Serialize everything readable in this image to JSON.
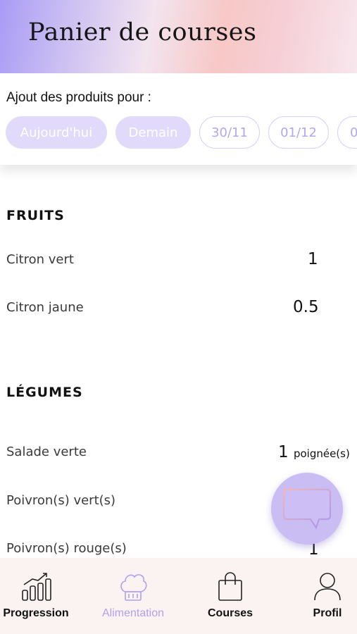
{
  "header": {
    "title": "Panier de courses"
  },
  "date_selector": {
    "label": "Ajout des produits pour :",
    "chips": [
      {
        "label": "Aujourd'hui",
        "state": "selected"
      },
      {
        "label": "Demain",
        "state": "selected"
      },
      {
        "label": "30/11",
        "state": "unselected"
      },
      {
        "label": "01/12",
        "state": "unselected"
      },
      {
        "label": "0",
        "state": "unselected"
      }
    ]
  },
  "sections": [
    {
      "title": "FRUITS",
      "items": [
        {
          "name": "Citron vert",
          "qty": "1",
          "unit": ""
        },
        {
          "name": "Citron jaune",
          "qty": "0.5",
          "unit": ""
        }
      ]
    },
    {
      "title": "LÉGUMES",
      "items": [
        {
          "name": "Salade verte",
          "qty": "1",
          "unit": "poignée(s)"
        },
        {
          "name": "Poivron(s) vert(s)",
          "qty": "",
          "unit": ""
        },
        {
          "name": "Poivron(s) rouge(s)",
          "qty": "1",
          "unit": ""
        }
      ]
    }
  ],
  "chat_button": {
    "icon": "chat-bubble-icon"
  },
  "bottom_nav": {
    "items": [
      {
        "label": "Progression",
        "icon": "bar-chart-icon",
        "active": false
      },
      {
        "label": "Alimentation",
        "icon": "chef-hat-icon",
        "active": true
      },
      {
        "label": "Courses",
        "icon": "shopping-bag-icon",
        "active": false
      },
      {
        "label": "Profil",
        "icon": "user-icon",
        "active": false
      }
    ]
  },
  "colors": {
    "accent": "#b0a0f0",
    "chip_selected_bg": "#e2dafb",
    "nav_bg": "#faf3f2"
  }
}
